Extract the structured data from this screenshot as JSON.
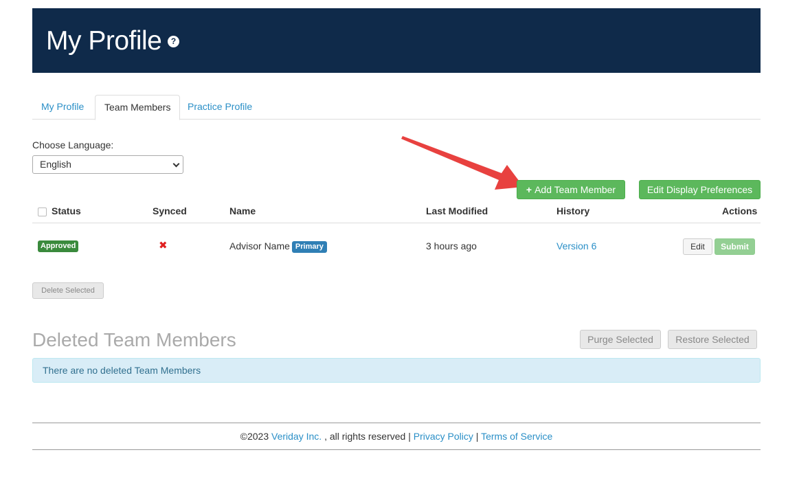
{
  "header": {
    "title": "My Profile",
    "help_icon": "question-circle-icon",
    "background": "#0f2a4a"
  },
  "tabs": [
    {
      "label": "My Profile",
      "active": false
    },
    {
      "label": "Team Members",
      "active": true
    },
    {
      "label": "Practice Profile",
      "active": false
    }
  ],
  "language": {
    "label": "Choose Language:",
    "selected": "English"
  },
  "toolbar": {
    "add_label": "Add Team Member",
    "add_icon": "plus-icon",
    "display_prefs_label": "Edit Display Preferences"
  },
  "table": {
    "columns": {
      "status": "Status",
      "synced": "Synced",
      "name": "Name",
      "last_modified": "Last Modified",
      "history": "History",
      "actions": "Actions"
    },
    "rows": [
      {
        "status": "Approved",
        "synced_icon": "x-icon",
        "name": "Advisor Name",
        "name_badge": "Primary",
        "last_modified": "3 hours ago",
        "history": "Version 6",
        "edit_label": "Edit",
        "submit_label": "Submit"
      }
    ],
    "delete_label": "Delete Selected"
  },
  "deleted": {
    "title": "Deleted Team Members",
    "purge_label": "Purge Selected",
    "restore_label": "Restore Selected",
    "empty_message": "There are no deleted Team Members"
  },
  "footer": {
    "copyright_prefix": "©2023",
    "company": "Veriday Inc.",
    "rights": ", all rights reserved",
    "divider": "|",
    "privacy": "Privacy Policy",
    "terms": "Terms of Service"
  },
  "annotation": {
    "arrow_color": "#e8413f"
  },
  "colors": {
    "accent_green": "#5cb85c",
    "link_blue": "#2a8fc7",
    "badge_approved": "#3a8a3c",
    "badge_primary": "#2f7fb5",
    "info_bg": "#d9edf7"
  }
}
